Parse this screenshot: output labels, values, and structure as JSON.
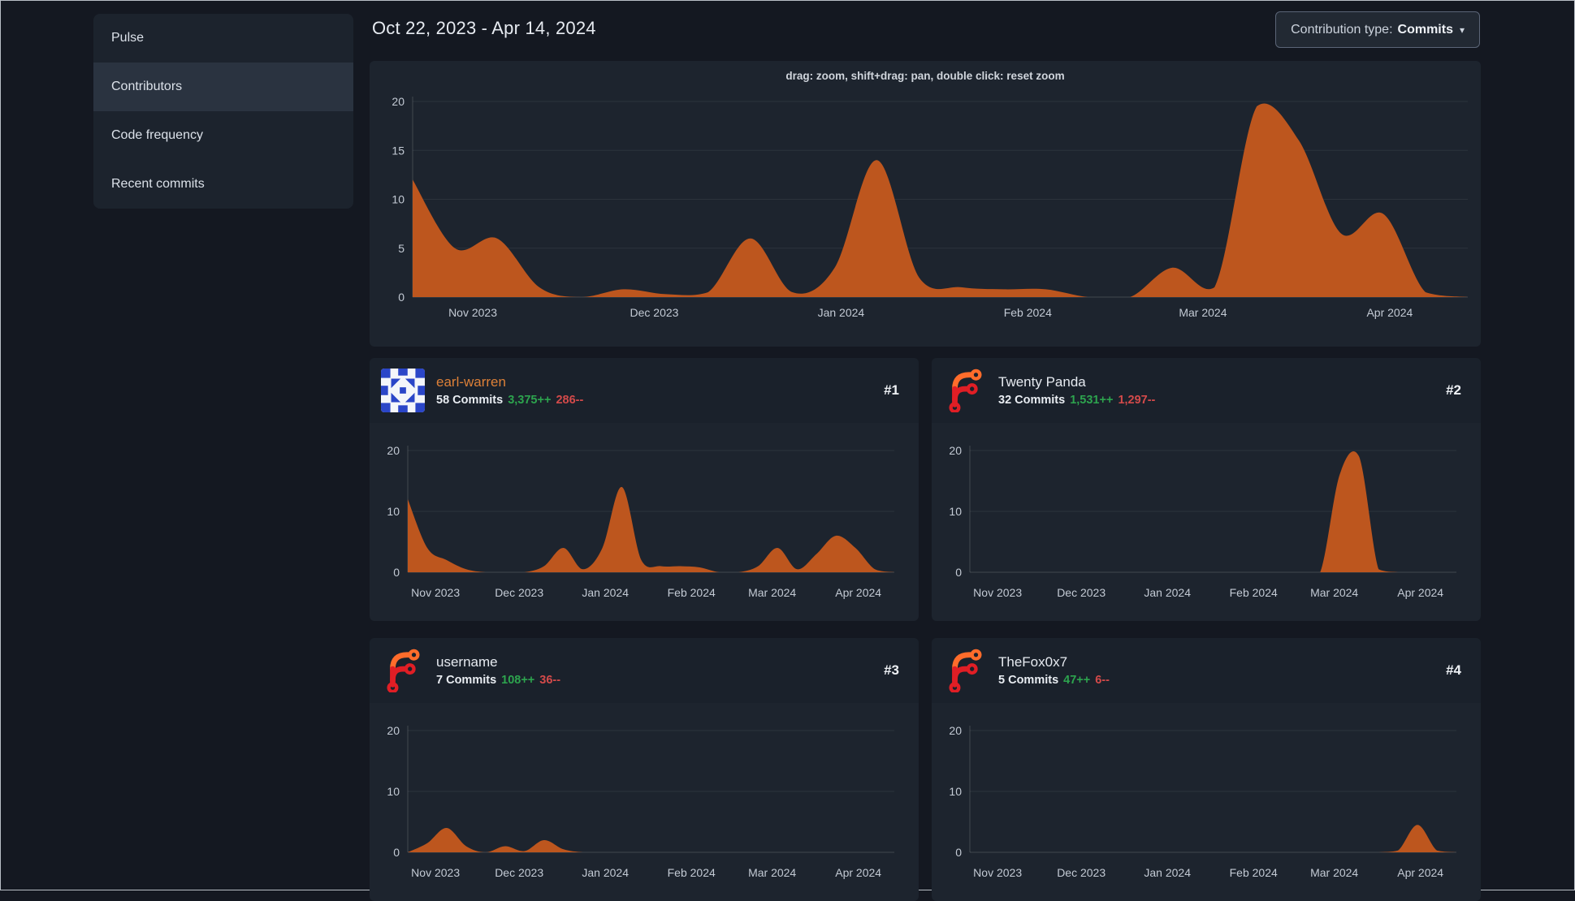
{
  "sidebar": {
    "items": [
      {
        "label": "Pulse",
        "active": false
      },
      {
        "label": "Contributors",
        "active": true
      },
      {
        "label": "Code frequency",
        "active": false
      },
      {
        "label": "Recent commits",
        "active": false
      }
    ]
  },
  "header": {
    "date_range": "Oct 22, 2023 - Apr 14, 2024",
    "contribution_type_label": "Contribution type:",
    "contribution_type_value": "Commits",
    "dropdown_caret": "▾"
  },
  "contributors": [
    {
      "rank": "#1",
      "name": "earl-warren",
      "is_link": true,
      "avatar": "identicon-blue",
      "commits": "58 Commits",
      "additions": "3,375++",
      "deletions": "286--"
    },
    {
      "rank": "#2",
      "name": "Twenty Panda",
      "is_link": false,
      "avatar": "forgejo-logo",
      "commits": "32 Commits",
      "additions": "1,531++",
      "deletions": "1,297--"
    },
    {
      "rank": "#3",
      "name": "username",
      "is_link": false,
      "avatar": "forgejo-logo",
      "commits": "7 Commits",
      "additions": "108++",
      "deletions": "36--"
    },
    {
      "rank": "#4",
      "name": "TheFox0x7",
      "is_link": false,
      "avatar": "forgejo-logo",
      "commits": "5 Commits",
      "additions": "47++",
      "deletions": "6--"
    }
  ],
  "colors": {
    "page_bg": "#141821",
    "panel_bg": "#1d242e",
    "card_head_bg": "#1a212b",
    "area_orange": "#bd561e",
    "link_orange": "#dd8038",
    "additions_green": "#2da44e",
    "deletions_red": "#d34a4a",
    "axis_text": "#c3cad4"
  },
  "x_axis_ticks": [
    {
      "label": "Nov 2023",
      "f": 0.057
    },
    {
      "label": "Dec 2023",
      "f": 0.229
    },
    {
      "label": "Jan 2024",
      "f": 0.406
    },
    {
      "label": "Feb 2024",
      "f": 0.583
    },
    {
      "label": "Mar 2024",
      "f": 0.749
    },
    {
      "label": "Apr 2024",
      "f": 0.926
    }
  ],
  "chart_data": [
    {
      "type": "area",
      "name": "overall-weekly-commits",
      "title": "drag: zoom, shift+drag: pan, double click: reset zoom",
      "x_range": [
        "Oct 22, 2023",
        "Apr 14, 2024"
      ],
      "weeks": [
        "Oct 22",
        "Oct 29",
        "Nov 5",
        "Nov 12",
        "Nov 19",
        "Nov 26",
        "Dec 3",
        "Dec 10",
        "Dec 17",
        "Dec 24",
        "Dec 31",
        "Jan 7",
        "Jan 14",
        "Jan 21",
        "Jan 28",
        "Feb 4",
        "Feb 11",
        "Feb 18",
        "Feb 25",
        "Mar 3",
        "Mar 10",
        "Mar 17",
        "Mar 24",
        "Mar 31",
        "Apr 7",
        "Apr 14"
      ],
      "values": [
        12,
        5,
        6,
        1,
        0,
        0.8,
        0.3,
        0.5,
        6,
        0.5,
        3,
        14,
        2,
        1,
        0.8,
        0.8,
        0,
        0,
        3,
        1,
        19.5,
        16,
        6.5,
        8.5,
        0.5,
        0
      ],
      "ylim": [
        0,
        20
      ],
      "yticks": [
        0,
        5,
        10,
        15,
        20
      ],
      "grid": true,
      "legend": "none",
      "color": "#bd561e"
    },
    {
      "type": "area",
      "name": "earl-warren-weekly-commits",
      "x_same_as_overall": true,
      "values": [
        12,
        4,
        2,
        0.5,
        0,
        0,
        0,
        1,
        4,
        0.5,
        4,
        14,
        2,
        1,
        1,
        0.8,
        0,
        0,
        1,
        4,
        0.5,
        3,
        6,
        4,
        0.5,
        0
      ],
      "ylim": [
        0,
        20
      ],
      "yticks": [
        0,
        10,
        20
      ],
      "grid": true,
      "color": "#bd561e"
    },
    {
      "type": "area",
      "name": "twenty-panda-weekly-commits",
      "x_same_as_overall": true,
      "values": [
        0,
        0,
        0,
        0,
        0,
        0,
        0,
        0,
        0,
        0,
        0,
        0,
        0,
        0,
        0,
        0,
        0,
        0,
        0,
        16,
        19,
        0.5,
        0,
        0,
        0,
        0
      ],
      "ylim": [
        0,
        20
      ],
      "yticks": [
        0,
        10,
        20
      ],
      "grid": true,
      "color": "#bd561e"
    },
    {
      "type": "area",
      "name": "username-weekly-commits",
      "x_same_as_overall": true,
      "values": [
        0,
        1.5,
        4,
        1,
        0,
        1,
        0.2,
        2,
        0.5,
        0,
        0,
        0,
        0,
        0,
        0,
        0,
        0,
        0,
        0,
        0,
        0,
        0,
        0,
        0,
        0,
        0
      ],
      "ylim": [
        0,
        20
      ],
      "yticks": [
        0,
        10,
        20
      ],
      "grid": true,
      "color": "#bd561e"
    },
    {
      "type": "area",
      "name": "thefox0x7-weekly-commits",
      "x_same_as_overall": true,
      "values": [
        0,
        0,
        0,
        0,
        0,
        0,
        0,
        0,
        0,
        0,
        0,
        0,
        0,
        0,
        0,
        0,
        0,
        0,
        0,
        0,
        0,
        0,
        0.3,
        4.5,
        0.3,
        0
      ],
      "ylim": [
        0,
        20
      ],
      "yticks": [
        0,
        10,
        20
      ],
      "grid": true,
      "color": "#bd561e"
    }
  ]
}
